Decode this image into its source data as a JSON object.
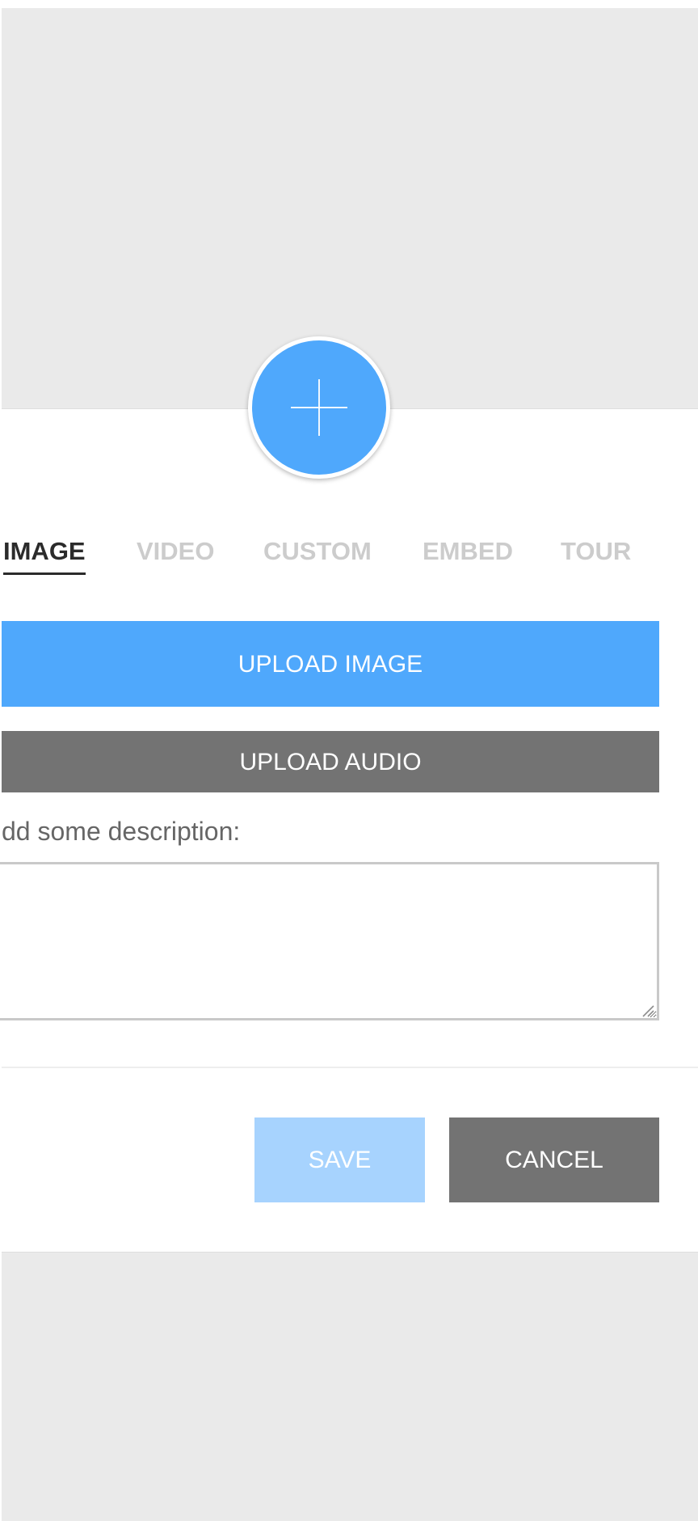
{
  "tabs": [
    {
      "label": "IMAGE",
      "active": true
    },
    {
      "label": "VIDEO",
      "active": false
    },
    {
      "label": "CUSTOM",
      "active": false
    },
    {
      "label": "EMBED",
      "active": false
    },
    {
      "label": "TOUR",
      "active": false
    }
  ],
  "buttons": {
    "upload_image": "UPLOAD IMAGE",
    "upload_audio": "UPLOAD AUDIO",
    "save": "SAVE",
    "cancel": "CANCEL"
  },
  "description": {
    "label": "dd some description:",
    "value": ""
  },
  "icons": {
    "add": "plus-icon",
    "resize": "resize-handle-icon"
  },
  "colors": {
    "accent": "#4fa8fc",
    "accent_light": "#a7d3fe",
    "secondary": "#737373",
    "canvas": "#eaeaea",
    "active_tab": "#2b2b2b",
    "inactive_tab": "#cccccc"
  }
}
